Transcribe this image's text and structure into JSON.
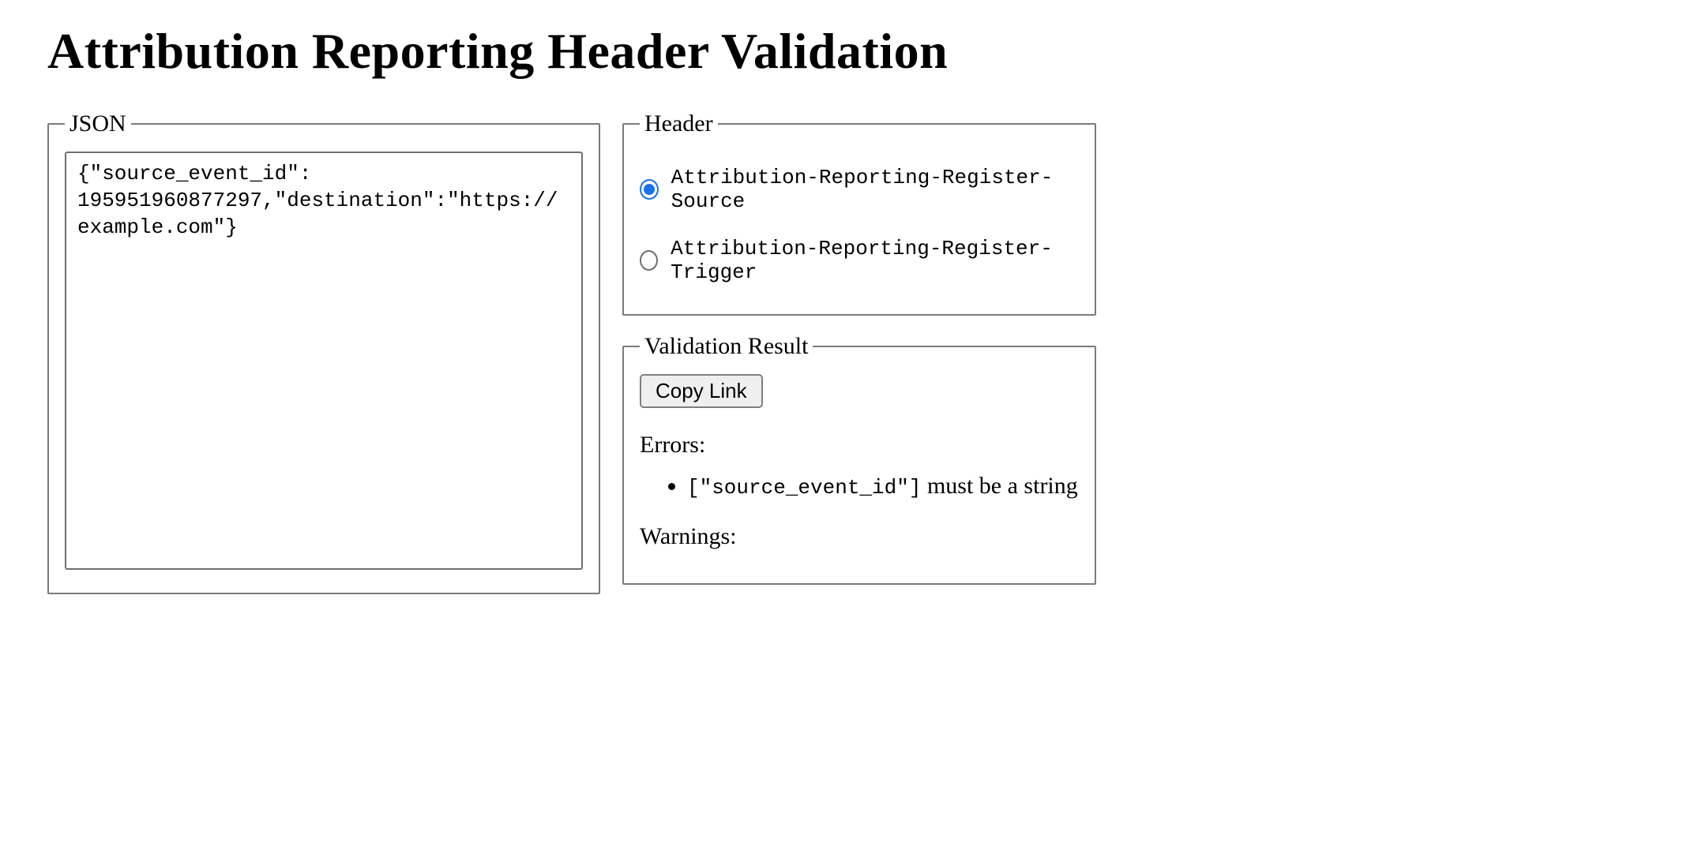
{
  "page_title": "Attribution Reporting Header Validation",
  "json_panel": {
    "legend": "JSON",
    "textarea_value": "{\"source_event_id\": 195951960877297,\"destination\":\"https://example.com\"}"
  },
  "header_panel": {
    "legend": "Header",
    "options": [
      {
        "label": "Attribution-Reporting-Register-Source",
        "checked": true
      },
      {
        "label": "Attribution-Reporting-Register-Trigger",
        "checked": false
      }
    ]
  },
  "result_panel": {
    "legend": "Validation Result",
    "copy_link_label": "Copy Link",
    "errors_label": "Errors:",
    "errors": [
      {
        "path": "[\"source_event_id\"]",
        "message": "must be a string"
      }
    ],
    "warnings_label": "Warnings:",
    "warnings": []
  }
}
